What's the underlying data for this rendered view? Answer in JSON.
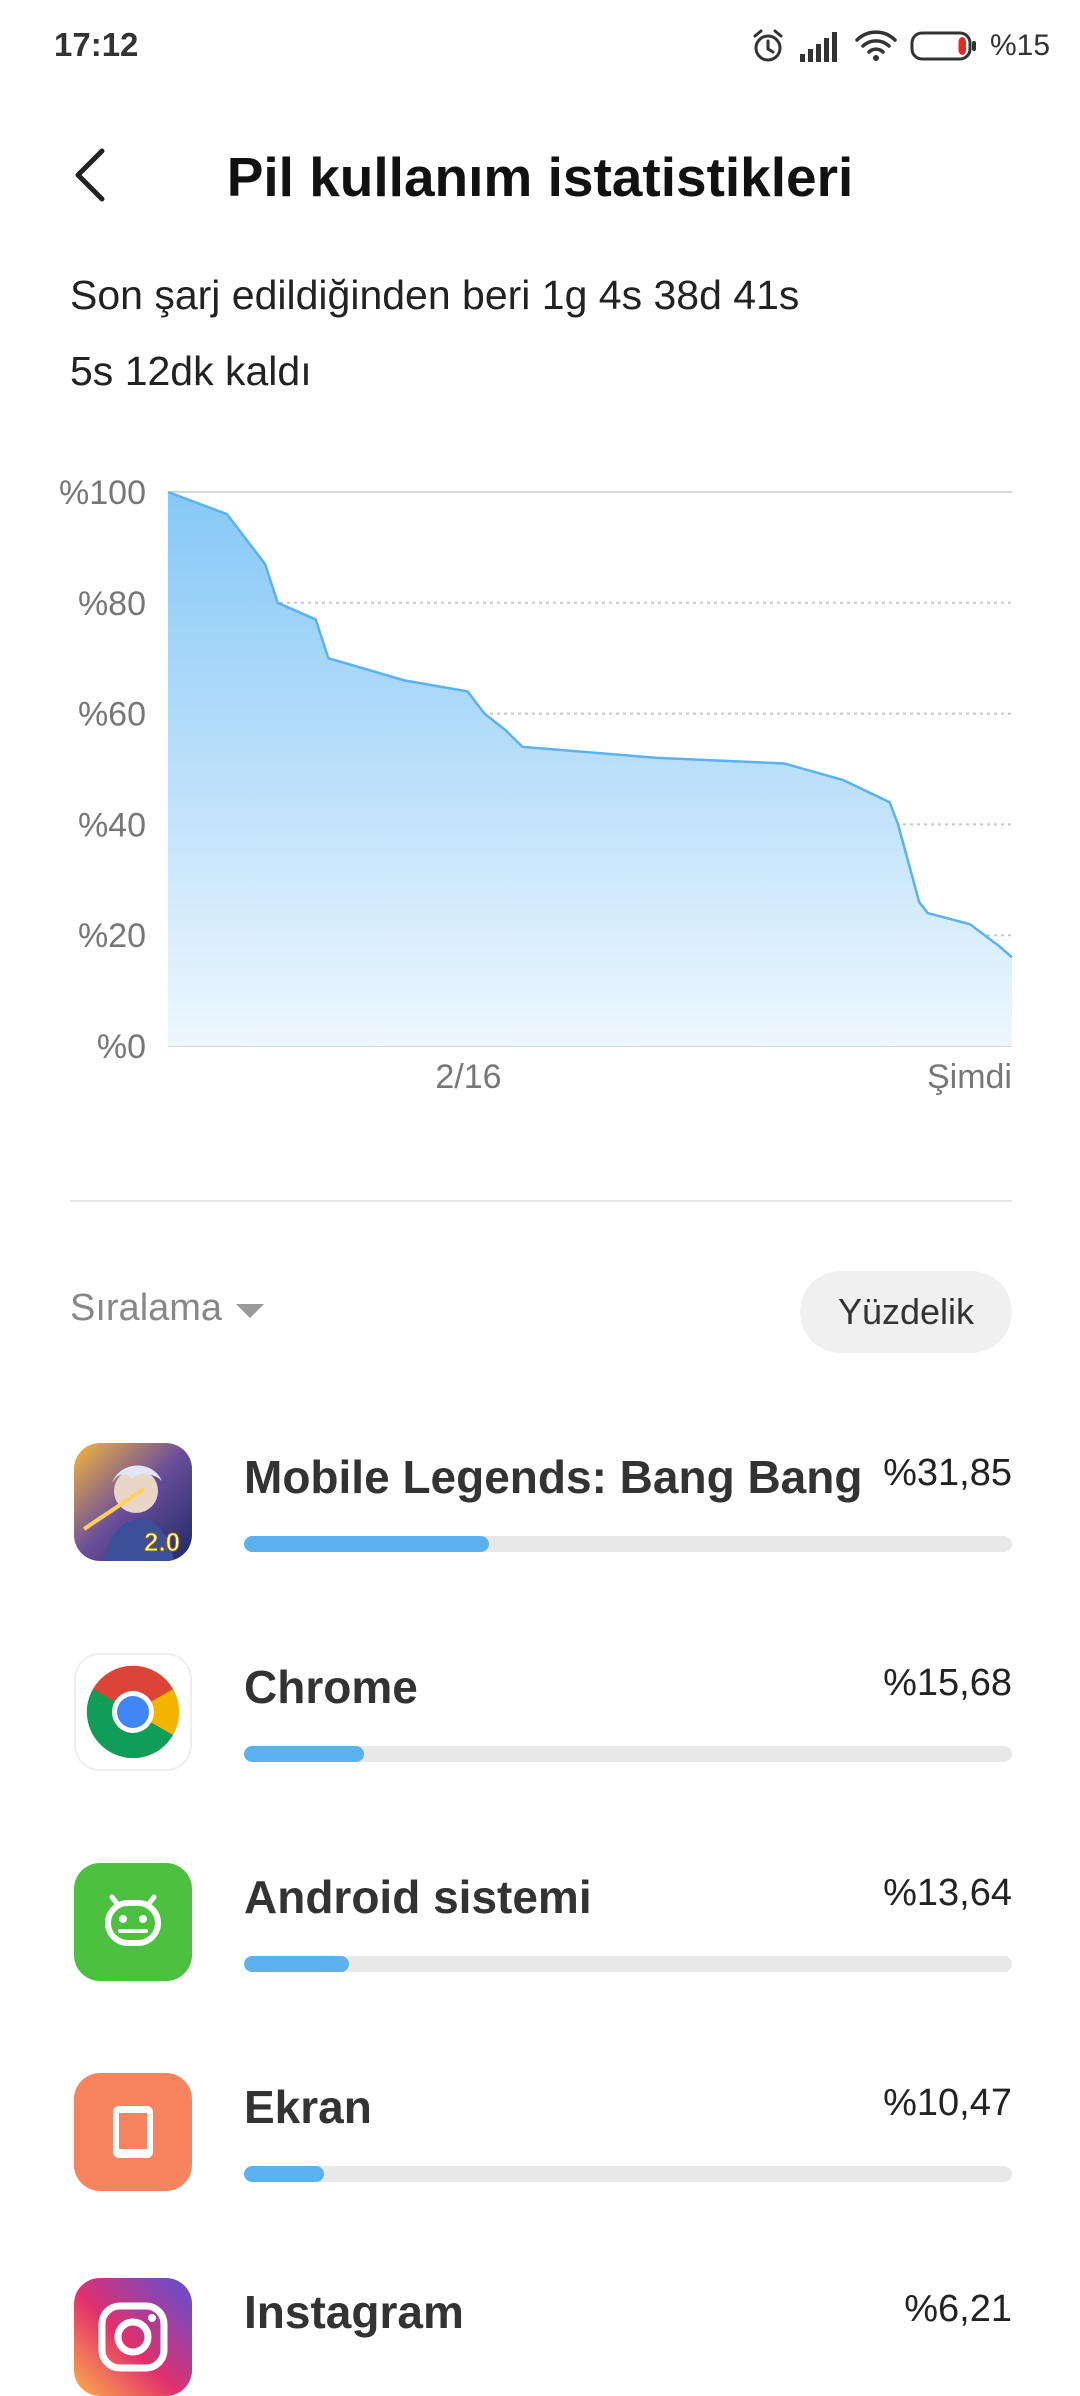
{
  "status_bar": {
    "time": "17:12",
    "battery_text": "%15",
    "icons": [
      "alarm-icon",
      "signal-icon",
      "wifi-icon",
      "battery-icon"
    ],
    "battery_level": 0.15
  },
  "header": {
    "title": "Pil kullanım istatistikleri",
    "back_icon": "back-arrow-icon"
  },
  "summary": {
    "since_charge": "Son şarj edildiğinden beri 1g 4s 38d 41s",
    "remaining": "5s 12dk kaldı"
  },
  "chart_data": {
    "type": "area",
    "title": "",
    "xlabel": "",
    "ylabel": "",
    "ylim": [
      0,
      100
    ],
    "ytick_labels": [
      "%100",
      "%80",
      "%60",
      "%40",
      "%20",
      "%0"
    ],
    "yticks": [
      100,
      80,
      60,
      40,
      20,
      0
    ],
    "xtick_labels": [
      "2/16",
      "Şimdi"
    ],
    "xtick_positions": [
      0.356,
      1.0
    ],
    "grid": true,
    "color": "#5bb2ef",
    "series": [
      {
        "x": [
          0,
          0.07,
          0.09,
          0.115,
          0.13,
          0.175,
          0.19,
          0.28,
          0.355,
          0.375,
          0.4,
          0.42,
          0.58,
          0.73,
          0.8,
          0.855,
          0.865,
          0.89,
          0.9,
          0.95,
          0.985,
          1.0
        ],
        "values": [
          100,
          96,
          92,
          87,
          80,
          77,
          70,
          66,
          64,
          60,
          57,
          54,
          52,
          51,
          48,
          44,
          40,
          26,
          24,
          22,
          18,
          16
        ]
      }
    ]
  },
  "sort": {
    "label": "Sıralama",
    "toggle_label": "Yüzdelik"
  },
  "apps": [
    {
      "name": "Mobile Legends: Bang Bang",
      "percent": "%31,85",
      "value": 31.85,
      "icon": "mobile-legends-icon"
    },
    {
      "name": "Chrome",
      "percent": "%15,68",
      "value": 15.68,
      "icon": "chrome-icon"
    },
    {
      "name": "Android sistemi",
      "percent": "%13,64",
      "value": 13.64,
      "icon": "android-icon"
    },
    {
      "name": "Ekran",
      "percent": "%10,47",
      "value": 10.47,
      "icon": "screen-icon"
    },
    {
      "name": "Instagram",
      "percent": "%6,21",
      "value": 6.21,
      "icon": "instagram-icon"
    }
  ],
  "colors": {
    "accent": "#5bb2ef",
    "android_green": "#4cc13f",
    "screen_orange": "#f7845f"
  }
}
